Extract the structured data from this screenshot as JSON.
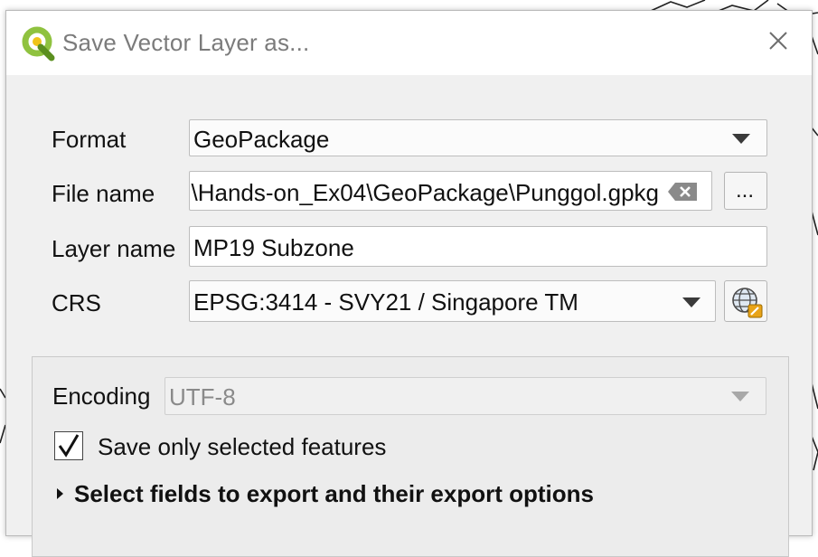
{
  "window": {
    "title": "Save Vector Layer as..."
  },
  "form": {
    "format_label": "Format",
    "format_value": "GeoPackage",
    "filename_label": "File name",
    "filename_value": "\\Hands-on_Ex04\\GeoPackage\\Punggol.gpkg",
    "browse_label": "...",
    "layername_label": "Layer name",
    "layername_value": "MP19 Subzone",
    "crs_label": "CRS",
    "crs_value": "EPSG:3414 - SVY21 / Singapore TM"
  },
  "options": {
    "encoding_label": "Encoding",
    "encoding_value": "UTF-8",
    "save_selected_label": "Save only selected features",
    "save_selected_checked": true,
    "fields_section_label": "Select fields to export and their export options"
  },
  "icons": {
    "app": "qgis-logo-icon",
    "close": "close-icon",
    "clear": "clear-text-icon",
    "crs_selector": "globe-crs-icon",
    "expand": "expand-triangle-icon"
  },
  "colors": {
    "qgis_green": "#8fc23f",
    "qgis_dark": "#5b8f1f",
    "crs_orange": "#e8a317",
    "disabled_text": "#8a8a8a"
  }
}
